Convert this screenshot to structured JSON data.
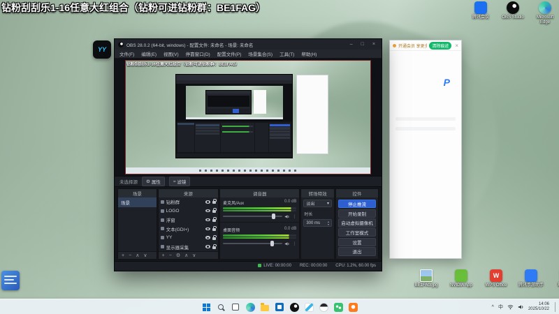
{
  "banner": {
    "title": "钻粉刮刮乐1-16任意大红组合（钻粉可进钻粉群：BE1FAG）"
  },
  "desktop": {
    "yy_badge": "YY",
    "top_icons": [
      {
        "name": "tencent-meeting",
        "label": "腾讯会议",
        "color": "#1d6ff2"
      },
      {
        "name": "obs-studio",
        "label": "OBS Studio",
        "color": "#0d0d0f"
      },
      {
        "name": "microsoft-edge",
        "label": "Microsoft Edge",
        "color": "#2ab3a8"
      }
    ],
    "bottom_icons": [
      {
        "name": "be1fag-image",
        "label": "BE1FAG.jpg",
        "color": "#9ec8ef"
      },
      {
        "name": "nvidia-app",
        "label": "NVIDIA App",
        "color": "#6abf3a"
      },
      {
        "name": "wps-office",
        "label": "WPS Office",
        "color": "#e33e30",
        "glyph": "W"
      },
      {
        "name": "game-assistant",
        "label": "腾讯手游助手",
        "color": "#2f7bf5"
      },
      {
        "name": "project-folder",
        "label": "项目文件",
        "color": "#f5c64a"
      }
    ]
  },
  "cleaner_window": {
    "promo_text": "开通会员 享更多权益",
    "button_label": "清除痕迹",
    "logo_letter": "P",
    "close_label": "×"
  },
  "obs": {
    "title": "OBS 28.0.2 (64-bit, windows) - 配置文件: 未命名 - 场景: 未命名",
    "window_buttons": {
      "min": "–",
      "max": "□",
      "close": "×"
    },
    "menus": [
      "文件(F)",
      "编辑(E)",
      "视图(V)",
      "停靠窗口(D)",
      "配置文件(P)",
      "场景集合(S)",
      "工具(T)",
      "帮助(H)"
    ],
    "source_toolbar": {
      "no_source_label": "未选择源",
      "properties_icon": "⚙",
      "properties_label": "属性",
      "filters_icon": "≈",
      "filters_label": "滤镜"
    },
    "docks": {
      "scenes": {
        "title": "场景",
        "items": [
          {
            "name": "场景",
            "selected": true
          }
        ],
        "toolbar": [
          "+",
          "−",
          "∧",
          "∨"
        ]
      },
      "sources": {
        "title": "来源",
        "items": [
          {
            "label": "钻粉群",
            "type": "group"
          },
          {
            "label": "LOGO",
            "type": "image"
          },
          {
            "label": "浮窗",
            "type": "browser"
          },
          {
            "label": "文本(GDI+)",
            "type": "text"
          },
          {
            "label": "YY",
            "type": "window"
          },
          {
            "label": "显示器采集",
            "type": "display"
          }
        ],
        "toolbar": [
          "+",
          "−",
          "⚙",
          "∧",
          "∨"
        ]
      },
      "mixer": {
        "title": "调音器",
        "channels": [
          {
            "label": "麦克风/Aux",
            "db": "0.0 dB",
            "level": 0.93
          },
          {
            "label": "桌面音频",
            "db": "0.0 dB",
            "level": 0.9
          }
        ],
        "dots": "⋮"
      },
      "transitions": {
        "title": "转场特效",
        "selected": "淡出",
        "caret": "▾",
        "duration_label": "时长",
        "duration_value": "300 ms",
        "spin_up": "▴",
        "spin_down": "▾"
      },
      "controls": {
        "title": "控件",
        "buttons": [
          {
            "label": "停止推流",
            "active": true
          },
          {
            "label": "开始录制"
          },
          {
            "label": "启动虚拟摄像机"
          },
          {
            "label": "工作室模式"
          },
          {
            "label": "设置"
          },
          {
            "label": "退出"
          }
        ]
      }
    },
    "statusbar": {
      "live": "LIVE: 00:00:00",
      "rec": "REC: 00:00:00",
      "stats": "CPU: 1.2%, 60.00 fps"
    }
  },
  "taskbar": {
    "apps": [
      "start",
      "search",
      "task-view",
      "edge",
      "file-explorer",
      "store",
      "obs-studio",
      "yy",
      "qq",
      "wechat",
      "douyu"
    ],
    "tray": {
      "chevron": "^",
      "ime": "中",
      "time": "14:06",
      "date": "2025/10/22"
    }
  }
}
